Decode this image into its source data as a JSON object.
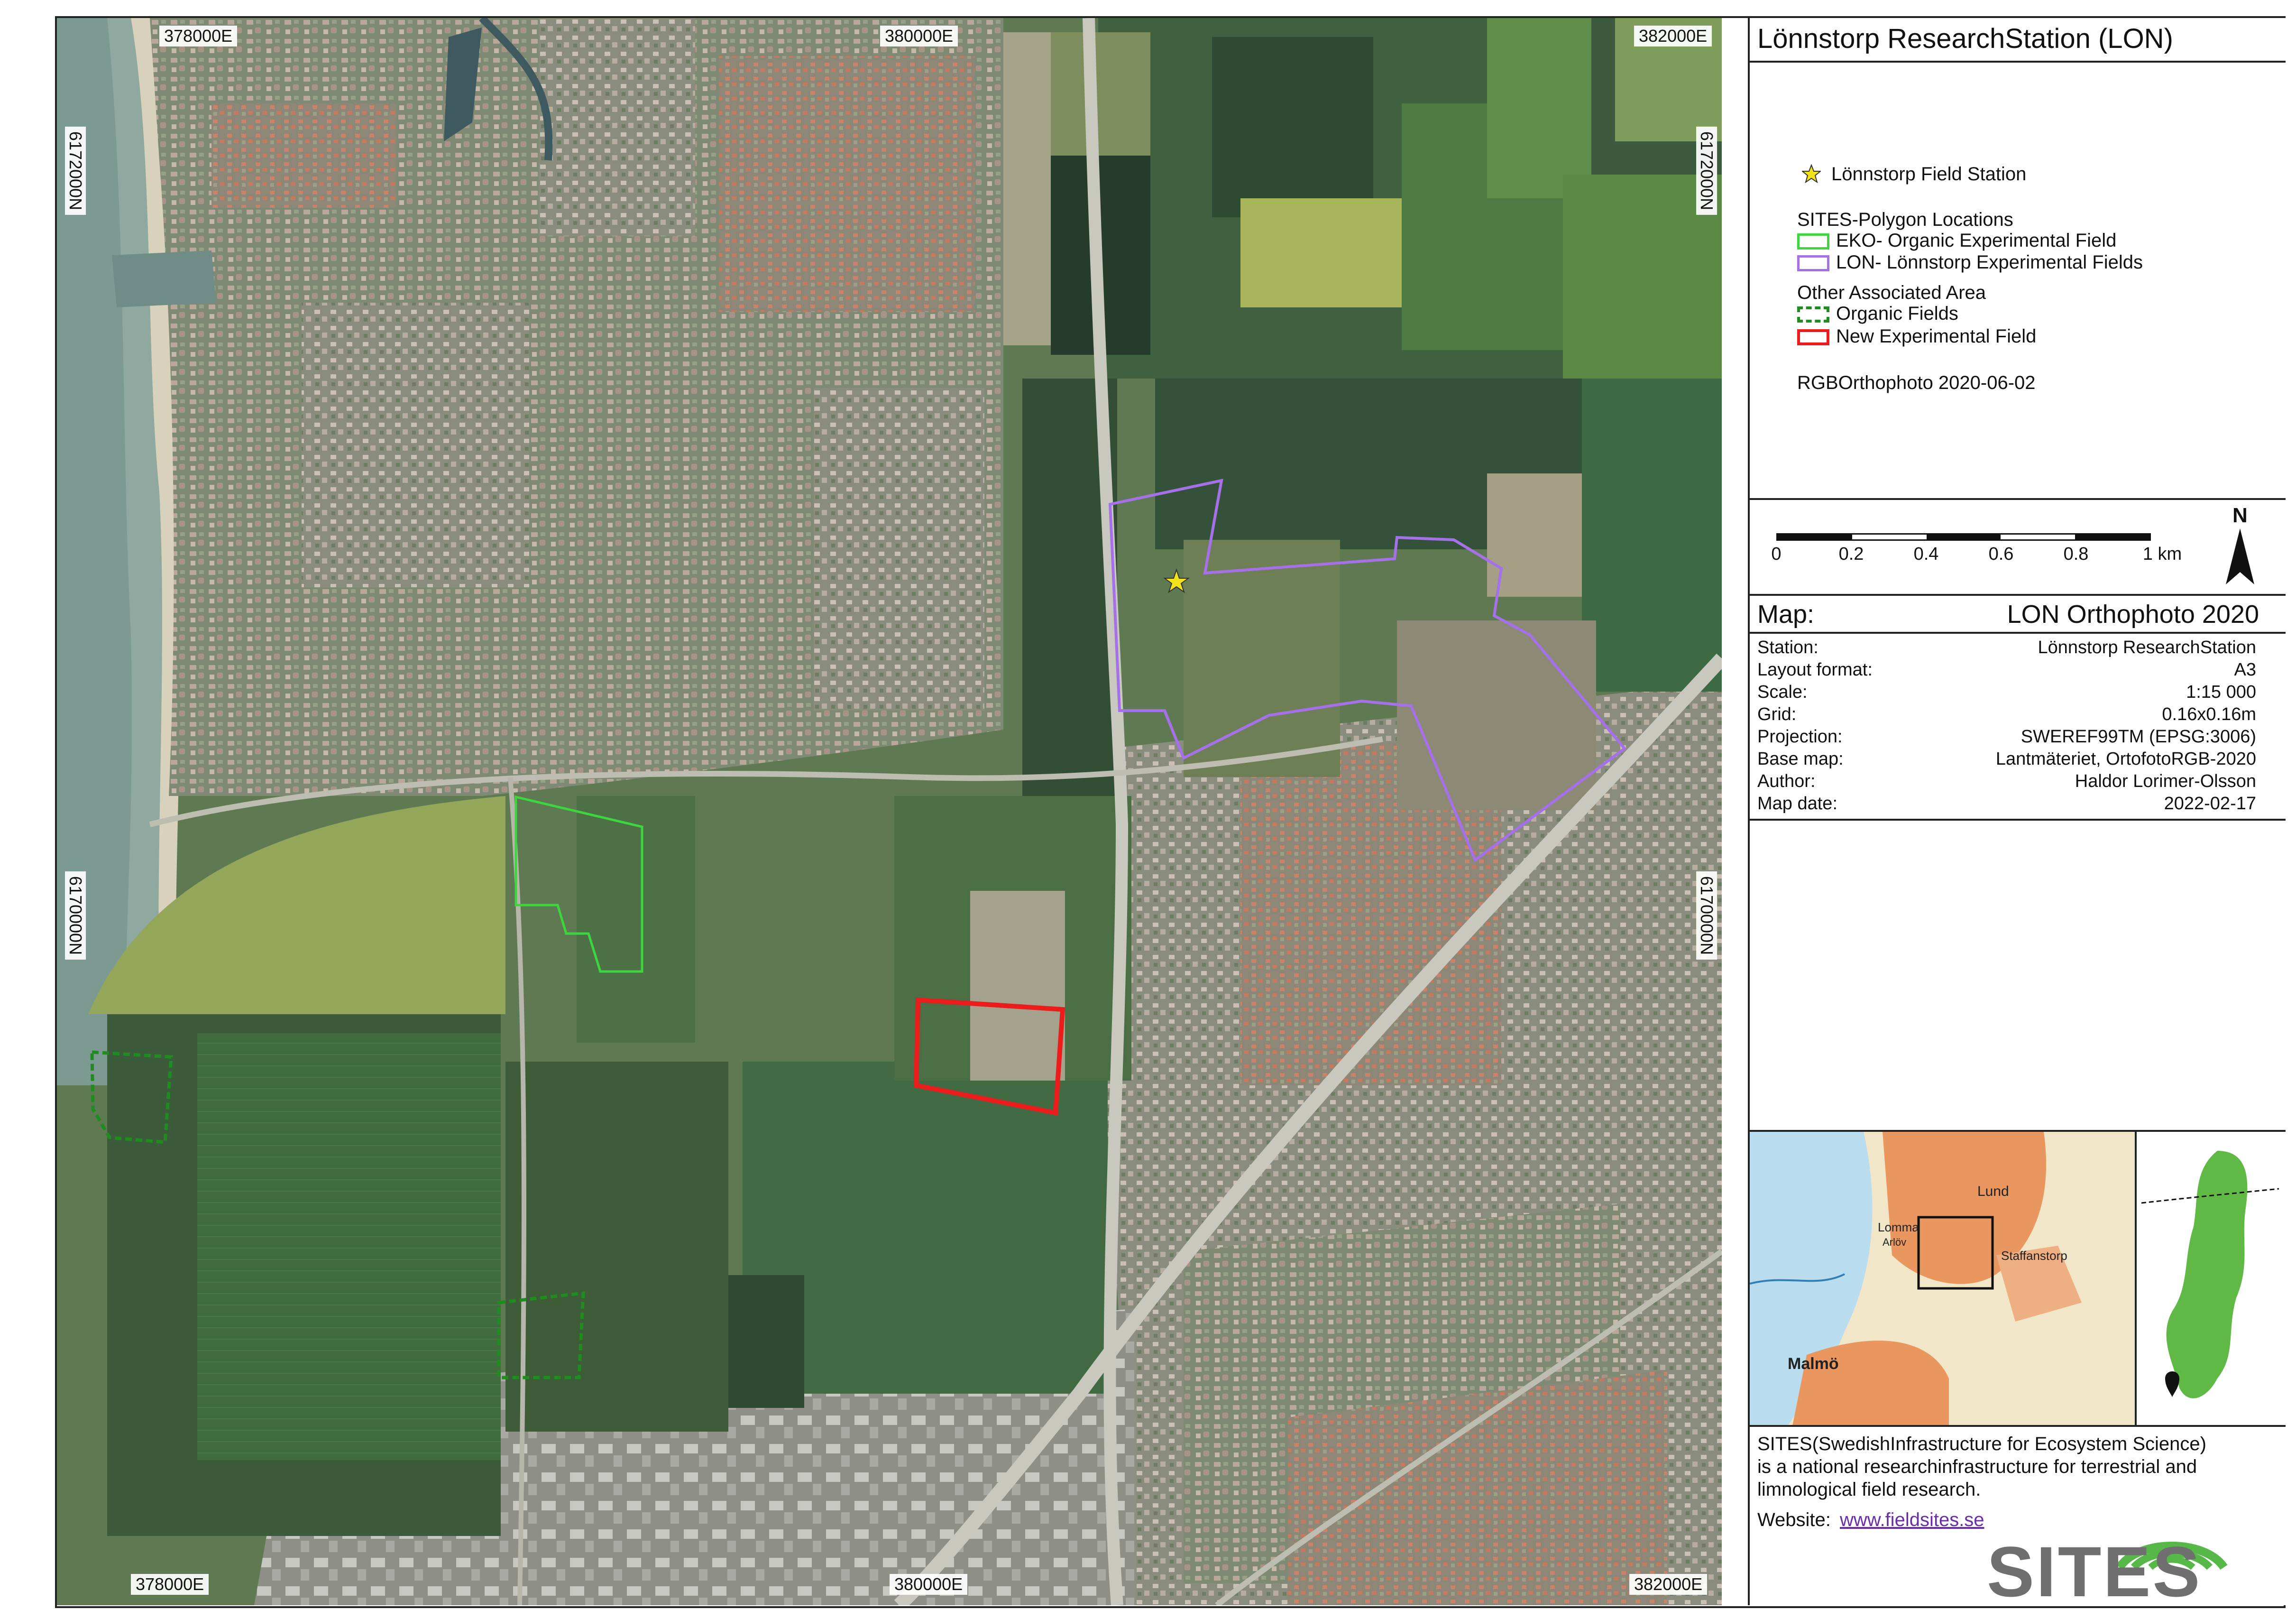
{
  "map": {
    "coords": {
      "top_1": "378000E",
      "top_2": "380000E",
      "top_3": "382000E",
      "bottom_1": "378000E",
      "bottom_2": "380000E",
      "bottom_3": "382000E",
      "left_1": "6172000N",
      "left_2": "6170000N",
      "right_1": "6172000N",
      "right_2": "6170000N"
    },
    "colors": {
      "eko": "#3ed63e",
      "lon": "#a570e8",
      "organic": "#1e8c1e",
      "new_field": "#ea1c1c",
      "star": "#f2e21a"
    }
  },
  "panel": {
    "title": "Lönnstorp ResearchStation (LON)",
    "legend": {
      "station_label": "Lönnstorp Field Station",
      "sites_header": "SITES-Polygon Locations",
      "eko_label": "EKO- Organic Experimental Field",
      "lon_label": "LON- Lönnstorp Experimental Fields",
      "other_header": "Other Associated Area",
      "organic_label": "Organic Fields",
      "new_label": "New Experimental Field",
      "ortho_label": "RGBOrthophoto  2020-06-02"
    },
    "scalebar": {
      "ticks": [
        "0",
        "0.2",
        "0.4",
        "0.6",
        "0.8",
        "1 km"
      ],
      "north_label": "N"
    },
    "map_header": {
      "label": "Map:",
      "name": "LON Orthophoto  2020"
    },
    "info": [
      {
        "key": "Station:",
        "value": "Lönnstorp ResearchStation"
      },
      {
        "key": "Layout format:",
        "value": "A3"
      },
      {
        "key": "Scale:",
        "value": "1:15 000"
      },
      {
        "key": "Grid:",
        "value": "0.16x0.16m"
      },
      {
        "key": "Projection:",
        "value": "SWEREF99TM (EPSG:3006)"
      },
      {
        "key": "Base map:",
        "value": "Lantmäteriet, OrtofotoRGB-2020"
      },
      {
        "key": "Author:",
        "value": "Haldor Lorimer-Olsson"
      },
      {
        "key": "Map date:",
        "value": "2022-02-17"
      }
    ],
    "inset": {
      "places": [
        "Lund",
        "Lomma",
        "Staffanstorp",
        "Malmö",
        "Arlöv"
      ]
    },
    "footer": {
      "line1": "SITES(SwedishInfrastructure  for  Ecosystem Science)",
      "line2": "is a national researchinfrastructure  for terrestrial  and",
      "line3": "limnological field research.",
      "website_label": "Website:",
      "website_url": "www.fieldsites.se",
      "logo_text": "SITES"
    }
  }
}
